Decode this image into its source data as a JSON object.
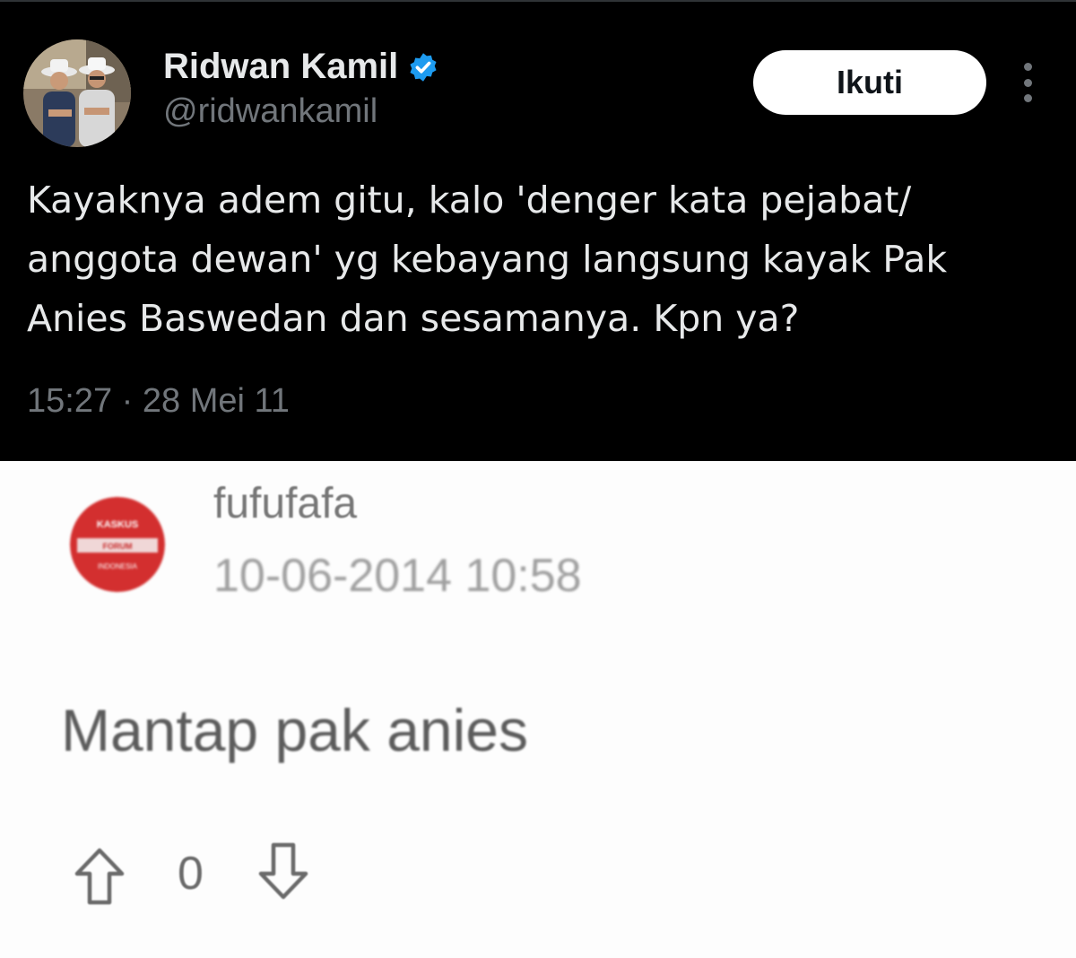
{
  "tweet": {
    "display_name": "Ridwan Kamil",
    "handle": "@ridwankamil",
    "follow_label": "Ikuti",
    "text_lines": [
      "Kayaknya adem gitu, kalo 'denger kata pejabat/",
      "anggota dewan' yg kebayang langsung kayak Pak",
      "Anies Baswedan dan sesamanya. Kpn ya?"
    ],
    "timestamp": "15:27 · 28 Mei 11",
    "verified_color": "#1d9bf0",
    "icons": {
      "verified": "verified-badge-icon",
      "more": "more-options-icon"
    }
  },
  "comment": {
    "username": "fufufafa",
    "date": "10-06-2014 10:58",
    "body": "Mantap pak anies",
    "vote_count": "0",
    "avatar_color": "#d32f2f",
    "icons": {
      "upvote": "arrow-up-icon",
      "downvote": "arrow-down-icon"
    }
  }
}
